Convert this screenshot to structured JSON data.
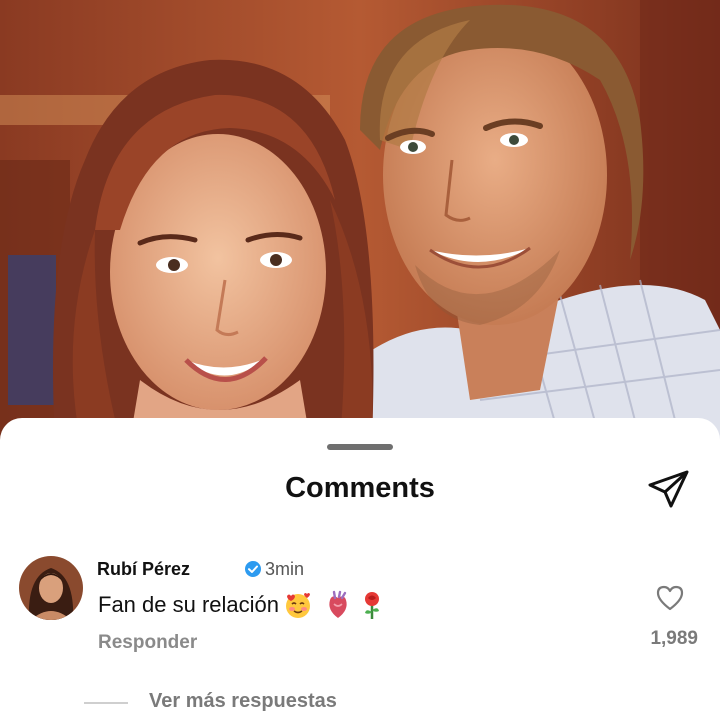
{
  "header": {
    "title": "Comments"
  },
  "comment": {
    "username": "Rubí Pérez",
    "time": "3min",
    "text": "Fan de su relación",
    "emojis": [
      "smiling-face-with-hearts-icon",
      "anatomical-heart-icon",
      "rose-icon"
    ],
    "reply_label": "Responder",
    "like_count": "1,989"
  },
  "thread": {
    "more_replies_label": "Ver más respuestas"
  },
  "icons": {
    "share": "paper-plane-icon",
    "like": "heart-outline-icon",
    "verified": "verified-badge-icon"
  },
  "colors": {
    "sheet_bg": "#ffffff",
    "verified_blue": "#2d9bf0",
    "muted_text": "#7a7a7a"
  }
}
